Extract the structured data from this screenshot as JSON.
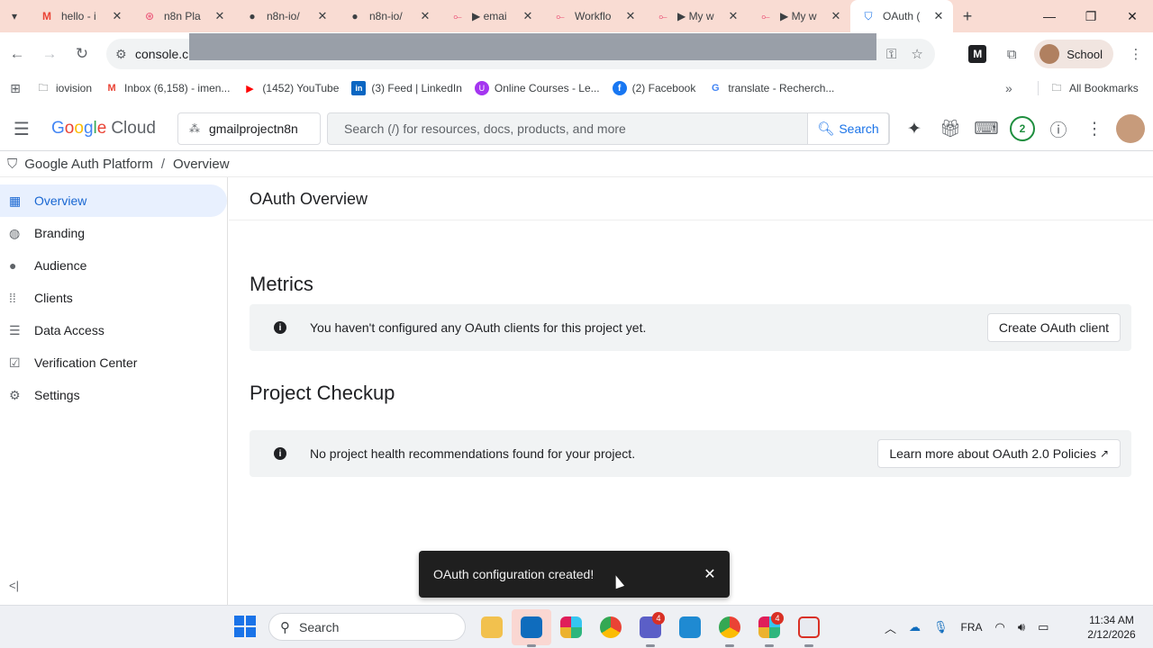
{
  "browser": {
    "tabs": [
      {
        "label": "hello - i",
        "icon": "gmail-icon"
      },
      {
        "label": "n8n Pla",
        "icon": "n8n-icon"
      },
      {
        "label": "n8n-io/",
        "icon": "github-icon"
      },
      {
        "label": "n8n-io/",
        "icon": "github-icon"
      },
      {
        "label": "▶ emai",
        "icon": "n8n-workflow-icon"
      },
      {
        "label": "Workflo",
        "icon": "n8n-workflow-icon"
      },
      {
        "label": "▶ My w",
        "icon": "n8n-workflow-icon"
      },
      {
        "label": "▶ My w",
        "icon": "n8n-workflow-icon"
      },
      {
        "label": "OAuth (",
        "icon": "shield-icon"
      }
    ],
    "address": "console.c",
    "profile": "School",
    "bookmarks": [
      {
        "label": "iovision",
        "icon": "folder-icon"
      },
      {
        "label": "Inbox (6,158) - imen...",
        "icon": "gmail-icon"
      },
      {
        "label": "(1452) YouTube",
        "icon": "youtube-icon"
      },
      {
        "label": "(3) Feed | LinkedIn",
        "icon": "linkedin-icon"
      },
      {
        "label": "Online Courses - Le...",
        "icon": "udemy-icon"
      },
      {
        "label": "(2) Facebook",
        "icon": "facebook-icon"
      },
      {
        "label": "translate - Recherch...",
        "icon": "google-icon"
      }
    ],
    "all_bookmarks": "All Bookmarks"
  },
  "gcp": {
    "logo_google": "Google",
    "logo_cloud": "Cloud",
    "project": "gmailprojectn8n",
    "search_placeholder": "Search (/) for resources, docs, products, and more",
    "search_button": "Search",
    "notifications": "2"
  },
  "breadcrumb": {
    "root": "Google Auth Platform",
    "sep": "/",
    "current": "Overview"
  },
  "sidebar": {
    "items": [
      {
        "label": "Overview",
        "icon": "dashboard-icon",
        "active": true
      },
      {
        "label": "Branding",
        "icon": "palette-icon"
      },
      {
        "label": "Audience",
        "icon": "person-icon"
      },
      {
        "label": "Clients",
        "icon": "grid-icon"
      },
      {
        "label": "Data Access",
        "icon": "data-access-icon"
      },
      {
        "label": "Verification Center",
        "icon": "checkbox-icon"
      },
      {
        "label": "Settings",
        "icon": "gear-icon"
      }
    ]
  },
  "main": {
    "title": "OAuth Overview",
    "metrics": {
      "heading": "Metrics",
      "message": "You haven't configured any OAuth clients for this project yet.",
      "button": "Create OAuth client"
    },
    "checkup": {
      "heading": "Project Checkup",
      "message": "No project health recommendations found for your project.",
      "button": "Learn more about OAuth 2.0 Policies"
    }
  },
  "snackbar": {
    "message": "OAuth configuration created!"
  },
  "taskbar": {
    "search": "Search",
    "lang": "FRA",
    "time": "11:34 AM",
    "date": "2/12/2026",
    "badges": {
      "teams": "4",
      "slack": "4"
    }
  },
  "colors": {
    "tabstrip": "#f9dcd3",
    "accent": "#1a73e8",
    "active_nav_bg": "#e8f0fe",
    "snackbar_bg": "#1f1f1f"
  }
}
